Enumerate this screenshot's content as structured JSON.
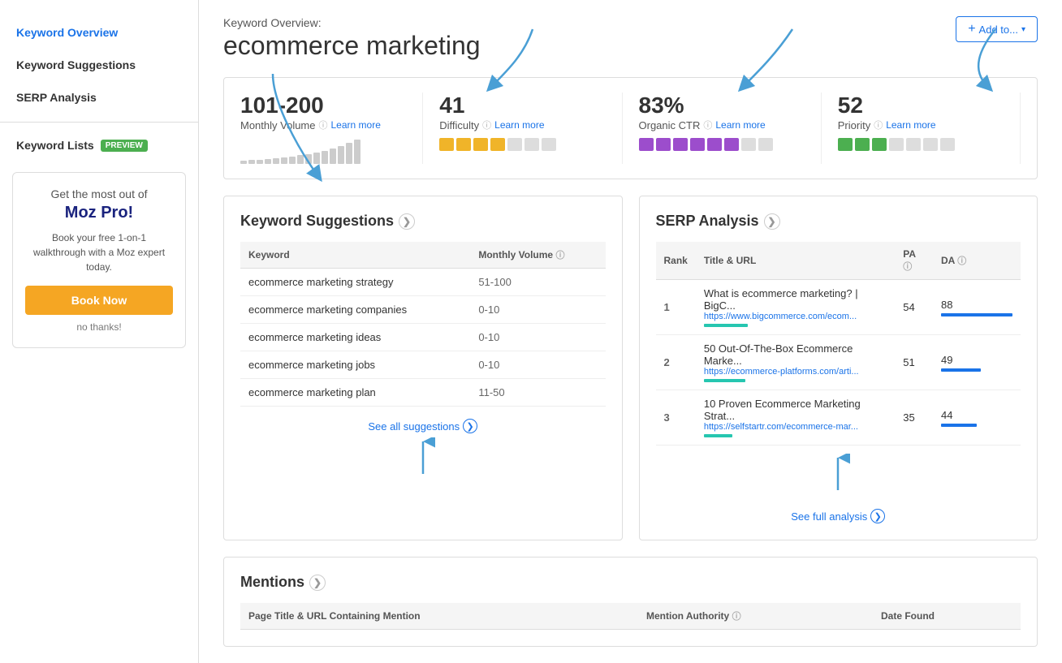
{
  "sidebar": {
    "items": [
      {
        "label": "Keyword Overview",
        "active": true
      },
      {
        "label": "Keyword Suggestions",
        "active": false
      },
      {
        "label": "SERP Analysis",
        "active": false
      }
    ],
    "keyword_lists_label": "Keyword Lists",
    "preview_badge": "PREVIEW"
  },
  "promo": {
    "title": "Get the most out of",
    "headline": "Moz Pro!",
    "desc": "Book your free 1-on-1 walkthrough with a Moz expert today.",
    "btn_label": "Book Now",
    "no_thanks": "no thanks!"
  },
  "header": {
    "subtitle": "Keyword Overview:",
    "title": "ecommerce marketing",
    "add_to_label": "Add to...",
    "add_to_plus": "+"
  },
  "metrics": [
    {
      "value": "101-200",
      "label": "Monthly Volume",
      "learn_more": "Learn more",
      "type": "volume"
    },
    {
      "value": "41",
      "label": "Difficulty",
      "learn_more": "Learn more",
      "type": "difficulty",
      "filled": 4,
      "total": 7
    },
    {
      "value": "83%",
      "label": "Organic CTR",
      "learn_more": "Learn more",
      "type": "ctr",
      "filled": 6,
      "total": 8
    },
    {
      "value": "52",
      "label": "Priority",
      "learn_more": "Learn more",
      "type": "priority",
      "filled": 3,
      "total": 7
    }
  ],
  "keyword_suggestions": {
    "title": "Keyword Suggestions",
    "col_keyword": "Keyword",
    "col_volume": "Monthly Volume",
    "rows": [
      {
        "keyword": "ecommerce marketing strategy",
        "volume": "51-100"
      },
      {
        "keyword": "ecommerce marketing companies",
        "volume": "0-10"
      },
      {
        "keyword": "ecommerce marketing ideas",
        "volume": "0-10"
      },
      {
        "keyword": "ecommerce marketing jobs",
        "volume": "0-10"
      },
      {
        "keyword": "ecommerce marketing plan",
        "volume": "11-50"
      }
    ],
    "see_all": "See all suggestions"
  },
  "serp_analysis": {
    "title": "SERP Analysis",
    "col_rank": "Rank",
    "col_title": "Title & URL",
    "col_pa": "PA",
    "col_da": "DA",
    "rows": [
      {
        "rank": "1",
        "title": "What is ecommerce marketing? | BigC...",
        "url": "https://www.bigcommerce.com/ecom...",
        "pa": 54,
        "da": 88,
        "pa_pct": 54,
        "da_pct": 88
      },
      {
        "rank": "2",
        "title": "50 Out-Of-The-Box Ecommerce Marke...",
        "url": "https://ecommerce-platforms.com/arti...",
        "pa": 51,
        "da": 49,
        "pa_pct": 51,
        "da_pct": 49
      },
      {
        "rank": "3",
        "title": "10 Proven Ecommerce Marketing Strat...",
        "url": "https://selfstartr.com/ecommerce-mar...",
        "pa": 35,
        "da": 44,
        "pa_pct": 35,
        "da_pct": 44
      }
    ],
    "see_full": "See full analysis"
  },
  "mentions": {
    "title": "Mentions",
    "col_page": "Page Title & URL Containing Mention",
    "col_authority": "Mention Authority",
    "col_date": "Date Found"
  },
  "icons": {
    "circle_arrow": "⊙",
    "info": "ⓘ",
    "nav_circle": "❯"
  }
}
